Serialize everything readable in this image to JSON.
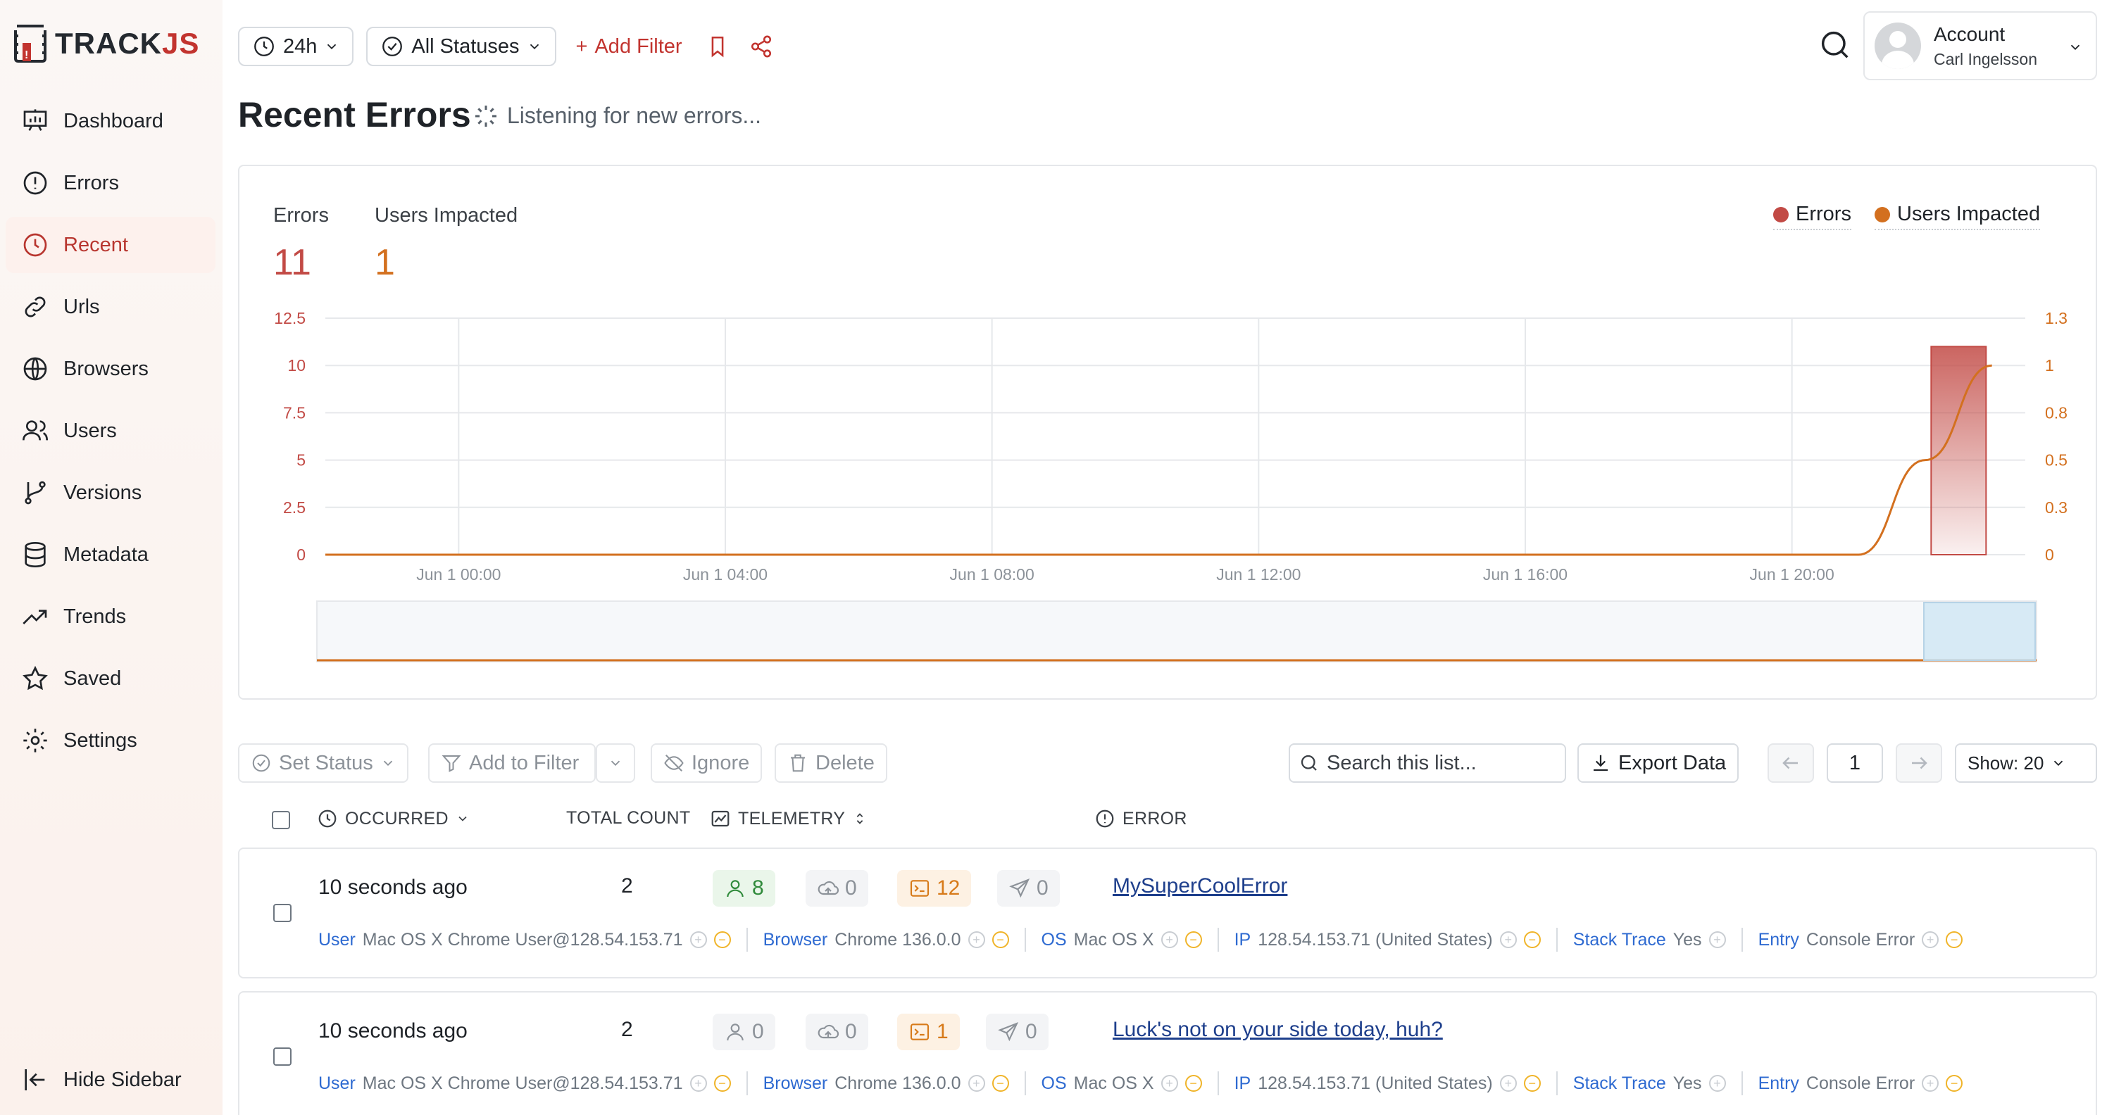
{
  "app": {
    "logo_text_a": "TRACK",
    "logo_text_b": "JS"
  },
  "sidebar": {
    "items": [
      {
        "label": "Dashboard",
        "icon": "dashboard-icon",
        "active": false
      },
      {
        "label": "Errors",
        "icon": "alert-circle-icon",
        "active": false
      },
      {
        "label": "Recent",
        "icon": "clock-icon",
        "active": true
      },
      {
        "label": "Urls",
        "icon": "link-icon",
        "active": false
      },
      {
        "label": "Browsers",
        "icon": "globe-icon",
        "active": false
      },
      {
        "label": "Users",
        "icon": "users-icon",
        "active": false
      },
      {
        "label": "Versions",
        "icon": "git-branch-icon",
        "active": false
      },
      {
        "label": "Metadata",
        "icon": "database-icon",
        "active": false
      },
      {
        "label": "Trends",
        "icon": "trend-icon",
        "active": false
      },
      {
        "label": "Saved",
        "icon": "star-icon",
        "active": false
      },
      {
        "label": "Settings",
        "icon": "gear-icon",
        "active": false
      }
    ],
    "hide_label": "Hide Sidebar"
  },
  "topbar": {
    "range": "24h",
    "status": "All Statuses",
    "add_filter": "Add Filter",
    "account_title": "Account",
    "account_user": "Carl Ingelsson"
  },
  "page": {
    "title": "Recent Errors",
    "listening": "Listening for new errors..."
  },
  "stats": {
    "errors_label": "Errors",
    "errors_value": "11",
    "users_label": "Users Impacted",
    "users_value": "1"
  },
  "legend": {
    "errors": "Errors",
    "users": "Users Impacted"
  },
  "colors": {
    "errors": "#c24a45",
    "users": "#d3701f",
    "accent": "#c2342f"
  },
  "chart_data": {
    "type": "bar",
    "x_tick_labels": [
      "Jun 1 00:00",
      "Jun 1 04:00",
      "Jun 1 08:00",
      "Jun 1 12:00",
      "Jun 1 16:00",
      "Jun 1 20:00"
    ],
    "y_left_ticks": [
      "12.5",
      "10",
      "7.5",
      "5",
      "2.5",
      "0"
    ],
    "y_right_ticks": [
      "1.3",
      "1",
      "0.8",
      "0.5",
      "0.3",
      "0"
    ],
    "ylim_left": [
      0,
      12.5
    ],
    "ylim_right": [
      0,
      1.25
    ],
    "x_range_hours": [
      -2,
      23.5
    ],
    "series": [
      {
        "name": "Errors",
        "type": "bar",
        "axis": "left",
        "points": [
          {
            "x": 22.5,
            "y": 11
          }
        ]
      },
      {
        "name": "Users Impacted",
        "type": "line",
        "axis": "right",
        "points": [
          [
            -2,
            0
          ],
          [
            21,
            0
          ],
          [
            22,
            0.5
          ],
          [
            23,
            1
          ]
        ]
      }
    ],
    "grid": true,
    "legend": "top-right"
  },
  "toolbar": {
    "set_status": "Set Status",
    "add_to_filter": "Add to Filter",
    "ignore": "Ignore",
    "delete": "Delete",
    "search_placeholder": "Search this list...",
    "export": "Export Data",
    "page": "1",
    "show": "Show: 20"
  },
  "columns": {
    "occurred": "OCCURRED",
    "total": "TOTAL COUNT",
    "telemetry": "TELEMETRY",
    "error": "ERROR"
  },
  "rows": [
    {
      "occurred": "10 seconds ago",
      "count": "2",
      "telemetry": {
        "users": "8",
        "network": "0",
        "console": "12",
        "navigation": "0"
      },
      "error": "MySuperCoolError",
      "user_key": "User",
      "user_val": "Mac OS X Chrome User@128.54.153.71",
      "browser_key": "Browser",
      "browser_val": "Chrome 136.0.0",
      "os_key": "OS",
      "os_val": "Mac OS X",
      "ip_key": "IP",
      "ip_val": "128.54.153.71 (United States)",
      "stack_key": "Stack Trace",
      "stack_val": "Yes",
      "entry_key": "Entry",
      "entry_val": "Console Error"
    },
    {
      "occurred": "10 seconds ago",
      "count": "2",
      "telemetry": {
        "users": "0",
        "network": "0",
        "console": "1",
        "navigation": "0"
      },
      "error": "Luck's not on your side today, huh?",
      "user_key": "User",
      "user_val": "Mac OS X Chrome User@128.54.153.71",
      "browser_key": "Browser",
      "browser_val": "Chrome 136.0.0",
      "os_key": "OS",
      "os_val": "Mac OS X",
      "ip_key": "IP",
      "ip_val": "128.54.153.71 (United States)",
      "stack_key": "Stack Trace",
      "stack_val": "Yes",
      "entry_key": "Entry",
      "entry_val": "Console Error"
    }
  ]
}
